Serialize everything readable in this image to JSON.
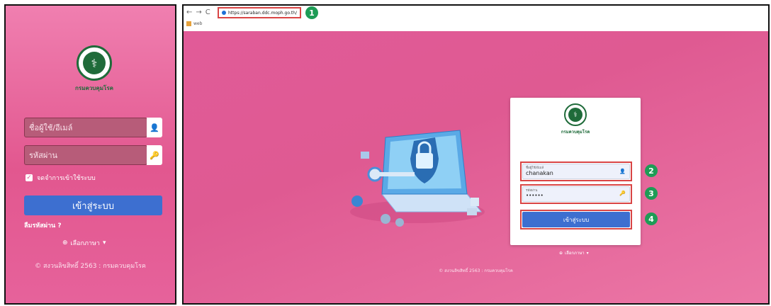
{
  "mobile": {
    "logo_text": "กรมควบคุมโรค",
    "username_placeholder": "ชื่อผู้ใช้/อีเมล์",
    "password_placeholder": "รหัสผ่าน",
    "remember_label": "จดจำการเข้าใช้ระบบ",
    "login_button": "เข้าสู่ระบบ",
    "forgot_link": "ลืมรหัสผ่าน ?",
    "language_label": "เลือกภาษา",
    "copyright": "© สงวนลิขสิทธิ์ 2563 : กรมควบคุมโรค",
    "user_icon": "user-icon",
    "key_icon": "key-icon",
    "check_icon": "check-icon",
    "globe_icon": "globe-icon"
  },
  "browser": {
    "url": "https://saraban.ddc.moph.go.th/",
    "bookmark": "web"
  },
  "login_card": {
    "logo_text": "กรมควบคุมโรค",
    "username_label": "ชื่อผู้ใช้/อีเมล์",
    "username_value": "chanakan",
    "password_label": "รหัสผ่าน",
    "password_value": "••••••",
    "login_button": "เข้าสู่ระบบ",
    "language_label": "เลือกภาษา"
  },
  "footer_copyright": "© สงวนลิขสิทธิ์ 2563 : กรมควบคุมโรค",
  "annotations": [
    "1",
    "2",
    "3",
    "4"
  ],
  "colors": {
    "bg_pink": "#e15b98",
    "button_blue": "#3d6fd0",
    "annotation_red": "#d94545",
    "badge_green": "#1e9c56",
    "logo_green": "#1f6b3a"
  }
}
